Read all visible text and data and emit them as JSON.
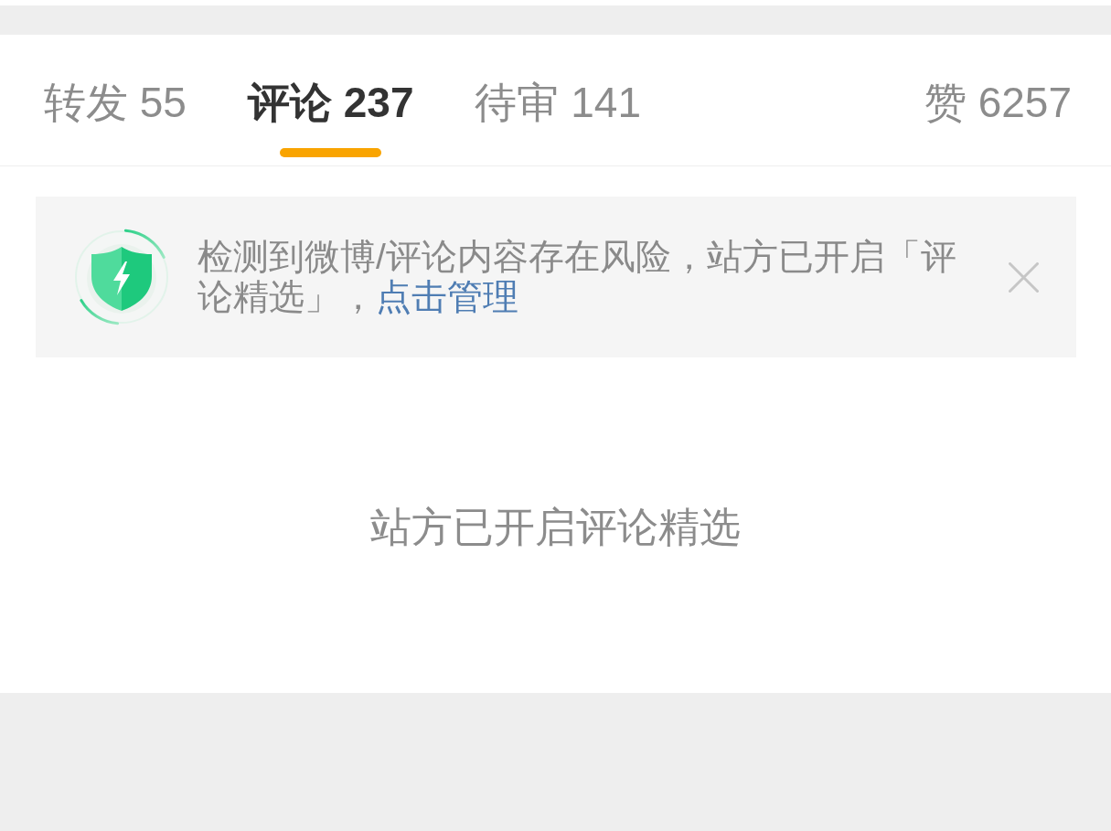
{
  "tabs": [
    {
      "label": "转发",
      "count": "55",
      "selected": false
    },
    {
      "label": "评论",
      "count": "237",
      "selected": true
    },
    {
      "label": "待审",
      "count": "141",
      "selected": false
    },
    {
      "label": "赞",
      "count": "6257",
      "selected": false
    }
  ],
  "notice": {
    "text": "检测到微博/评论内容存在风险，站方已开启「评论精选」，",
    "link": "点击管理"
  },
  "empty_state": {
    "message": "站方已开启评论精选"
  }
}
